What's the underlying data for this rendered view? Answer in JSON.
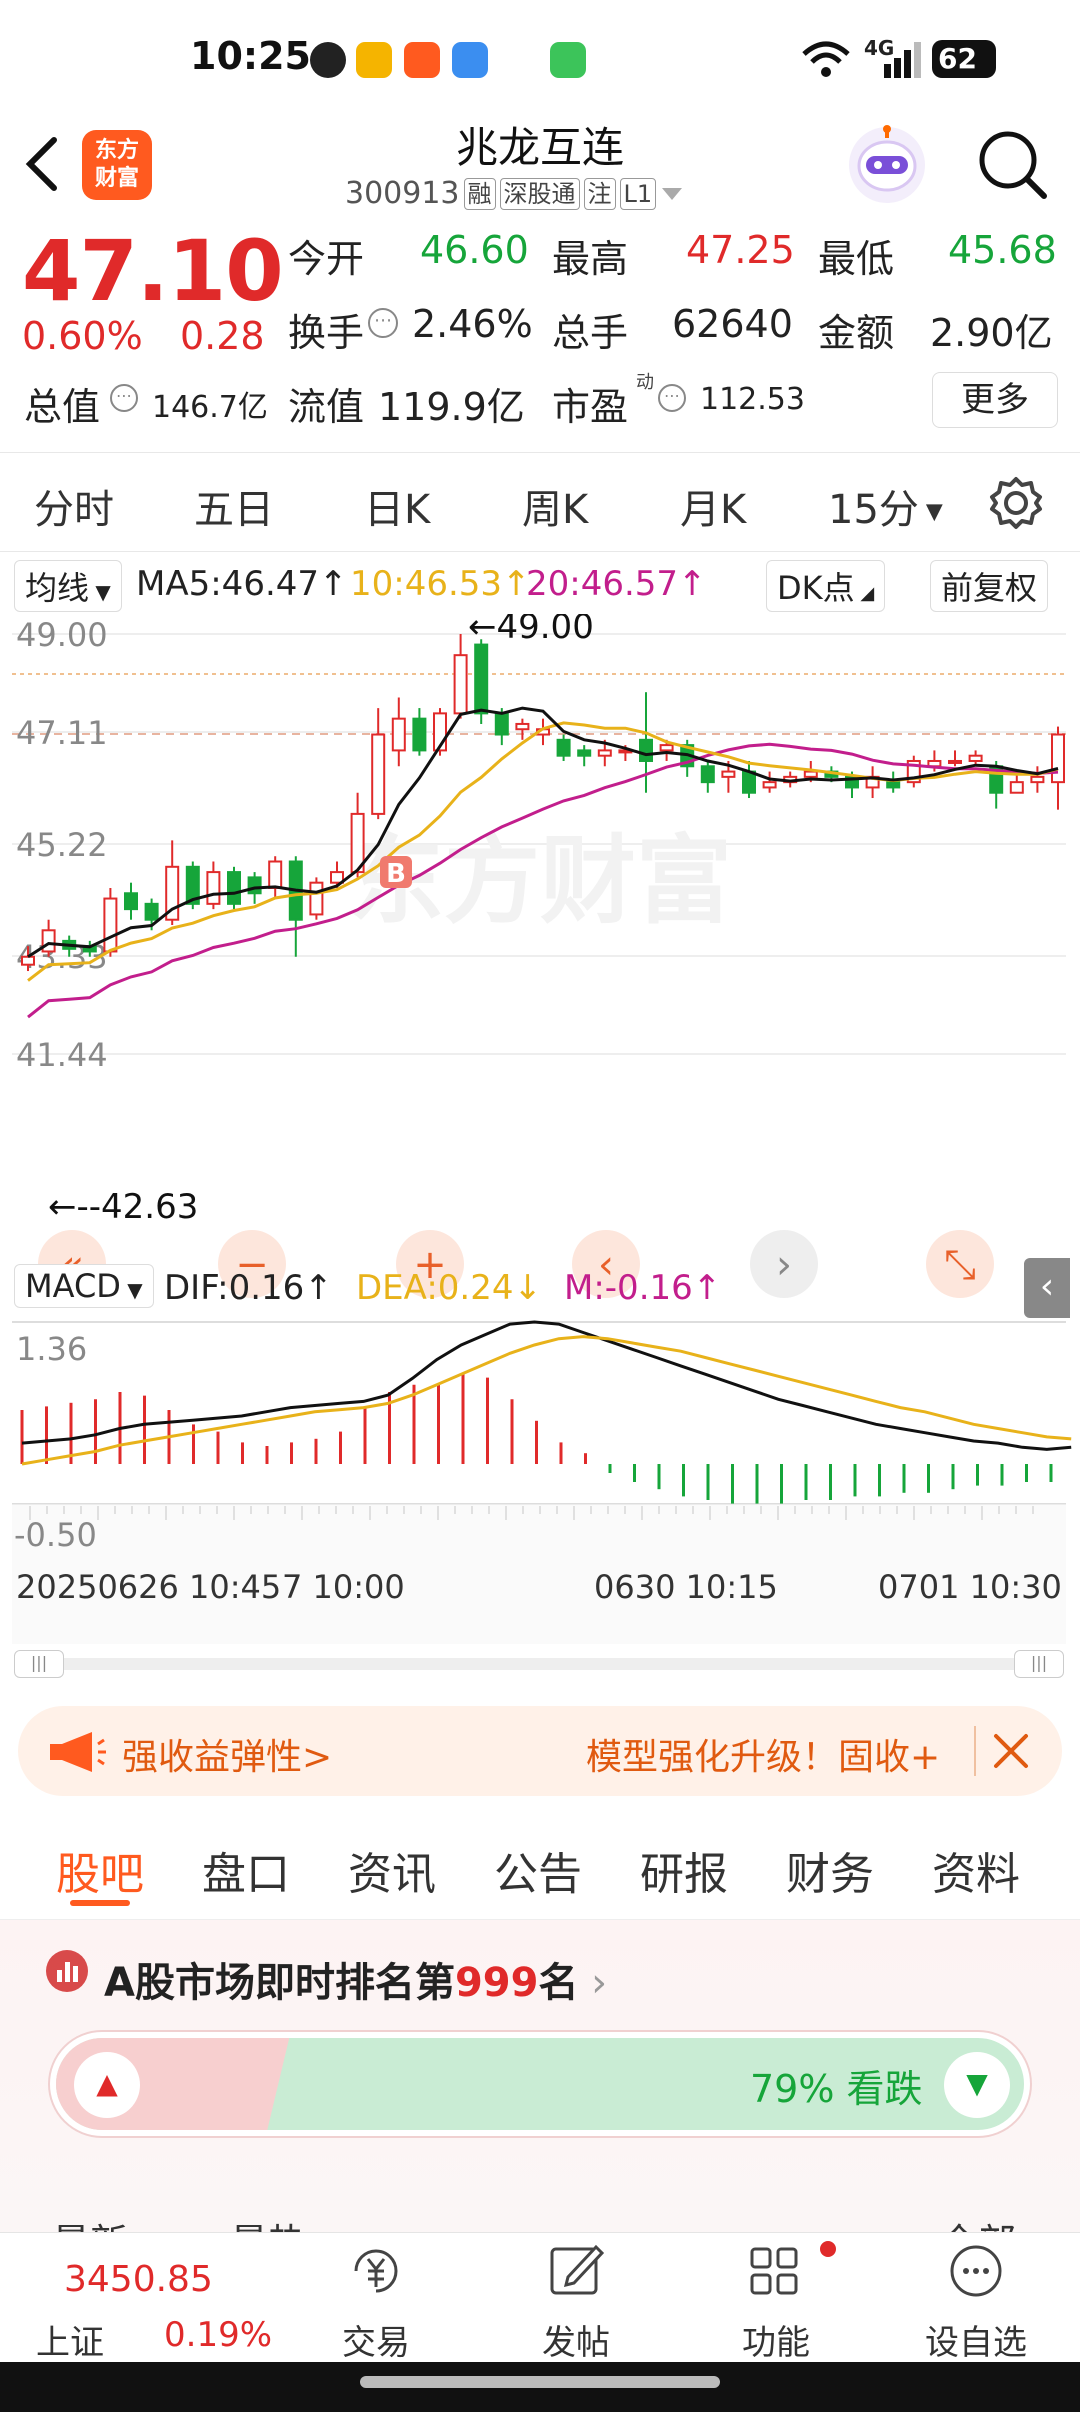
{
  "status_bar": {
    "time": "10:25",
    "network": "4G",
    "battery": "62"
  },
  "header": {
    "logo_text": "东方财富",
    "stock_name": "兆龙互连",
    "stock_code": "300913",
    "tags": [
      "融",
      "深股通",
      "注",
      "L1"
    ]
  },
  "quote": {
    "price": "47.10",
    "change_pct": "0.60%",
    "change_abs": "0.28",
    "open_label": "今开",
    "open": "46.60",
    "high_label": "最高",
    "high": "47.25",
    "low_label": "最低",
    "low": "45.68",
    "turnover_label": "换手",
    "turnover": "2.46%",
    "volume_label": "总手",
    "volume": "62640",
    "amount_label": "金额",
    "amount": "2.90亿",
    "mcap_label": "总值",
    "mcap": "146.7亿",
    "float_label": "流值",
    "float_value": "119.9亿",
    "pe_label": "市盈",
    "pe_sup": "动",
    "pe": "112.53",
    "more_label": "更多"
  },
  "period_tabs": [
    "分时",
    "五日",
    "日K",
    "周K",
    "月K",
    "15分"
  ],
  "ma_bar": {
    "selector": "均线",
    "ma5": "MA5:46.47↑",
    "ma10": "10:46.53↑",
    "ma20": "20:46.57↑",
    "dk": "DK点",
    "adjust": "前复权"
  },
  "kline": {
    "y_labels": [
      "49.00",
      "47.11",
      "45.22",
      "43.33",
      "41.44"
    ],
    "annot_high": "←49.00",
    "annot_low": "←--42.63",
    "b_marker": "B",
    "watermark": "东方财富",
    "colors": {
      "up": "#e02a2a",
      "down": "#16a53a",
      "ma5": "#111111",
      "ma10": "#e8b21a",
      "ma20": "#c21e8c"
    }
  },
  "macd": {
    "selector": "MACD",
    "dif": "DIF:0.16↑",
    "dea": "DEA:0.24↓",
    "m": "M:-0.16↑",
    "y_top": "1.36",
    "y_bottom": "-0.50"
  },
  "time_axis": {
    "t1": "20250626 10:45",
    "t1b": "7 10:00",
    "t2": "0630 10:15",
    "t3": "0701 10:30"
  },
  "banner": {
    "left_text": "强收益弹性>",
    "right_text": "模型强化升级！固收+"
  },
  "sub_tabs": [
    "股吧",
    "盘口",
    "资讯",
    "公告",
    "研报",
    "财务",
    "资料"
  ],
  "rank": {
    "prefix": "A股市场即时排名第",
    "number": "999",
    "suffix": "名",
    "bear_text": "79% 看跌",
    "bear_fraction": 0.79
  },
  "cut_text": {
    "left": "最新",
    "mid": "最热",
    "right": "全部"
  },
  "bottom_nav": {
    "index_value": "3450.85",
    "index_name": "上证",
    "index_change": "0.19%",
    "items": [
      "交易",
      "发帖",
      "功能",
      "设自选"
    ]
  }
}
